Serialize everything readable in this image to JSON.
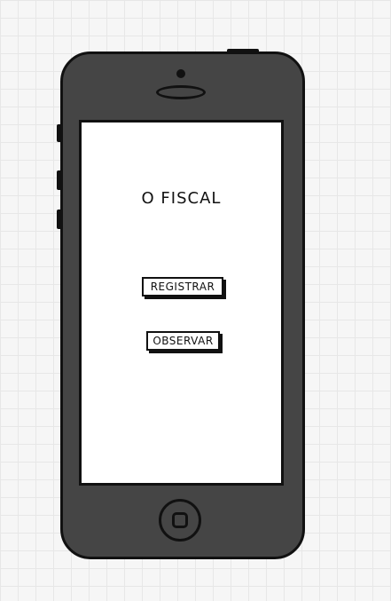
{
  "app": {
    "title": "O FISCAL"
  },
  "actions": {
    "registrar_label": "REGISTRAR",
    "observar_label": "OBSERVAR"
  },
  "icons": {
    "phone_frame": "phone-frame-icon",
    "camera": "camera-icon",
    "speaker": "speaker-icon",
    "home_button": "home-button-icon"
  },
  "colors": {
    "phone_body": "#454545",
    "screen": "#ffffff",
    "outline": "#111111",
    "background": "#f6f6f6"
  }
}
